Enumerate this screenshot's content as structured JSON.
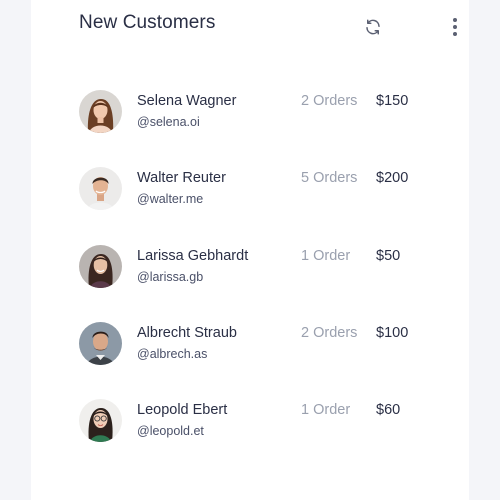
{
  "widget": {
    "title": "New Customers",
    "actions": [
      {
        "icon": "refresh-icon"
      },
      {
        "icon": "more-vertical-icon"
      }
    ]
  },
  "customers": [
    {
      "name": "Selena Wagner",
      "handle": "@selena.oi",
      "orders": "2 Orders",
      "amount": "$150",
      "avatar": "woman-long-brown-hair"
    },
    {
      "name": "Walter Reuter",
      "handle": "@walter.me",
      "orders": "5 Orders",
      "amount": "$200",
      "avatar": "man-short-dark-hair"
    },
    {
      "name": "Larissa Gebhardt",
      "handle": "@larissa.gb",
      "orders": "1 Order",
      "amount": "$50",
      "avatar": "woman-dark-hair"
    },
    {
      "name": "Albrecht Straub",
      "handle": "@albrech.as",
      "orders": "2 Orders",
      "amount": "$100",
      "avatar": "man-beard"
    },
    {
      "name": "Leopold Ebert",
      "handle": "@leopold.et",
      "orders": "1 Order",
      "amount": "$60",
      "avatar": "woman-glasses"
    }
  ],
  "colors": {
    "background": "#f4f5f9",
    "card": "#ffffff",
    "text_primary": "#2a2f45",
    "text_muted": "#9aa0ae"
  }
}
